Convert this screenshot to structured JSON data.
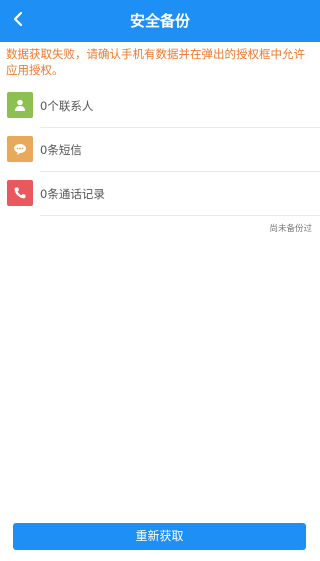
{
  "header": {
    "title": "安全备份",
    "back_icon": "chevron-left-icon",
    "background_color": "#1e8ff4"
  },
  "error_message": "数据获取失败，请确认手机有数据并在弹出的授权框中允许应用授权。",
  "items": [
    {
      "label": "0个联系人",
      "icon": "contact-icon",
      "icon_color": "#8cc152"
    },
    {
      "label": "0条短信",
      "icon": "message-icon",
      "icon_color": "#e9a95a"
    },
    {
      "label": "0条通话记录",
      "icon": "phone-icon",
      "icon_color": "#e8585d"
    }
  ],
  "backup_status": "尚未备份过",
  "action_button": {
    "label": "重新获取",
    "color": "#1e8ff4"
  }
}
